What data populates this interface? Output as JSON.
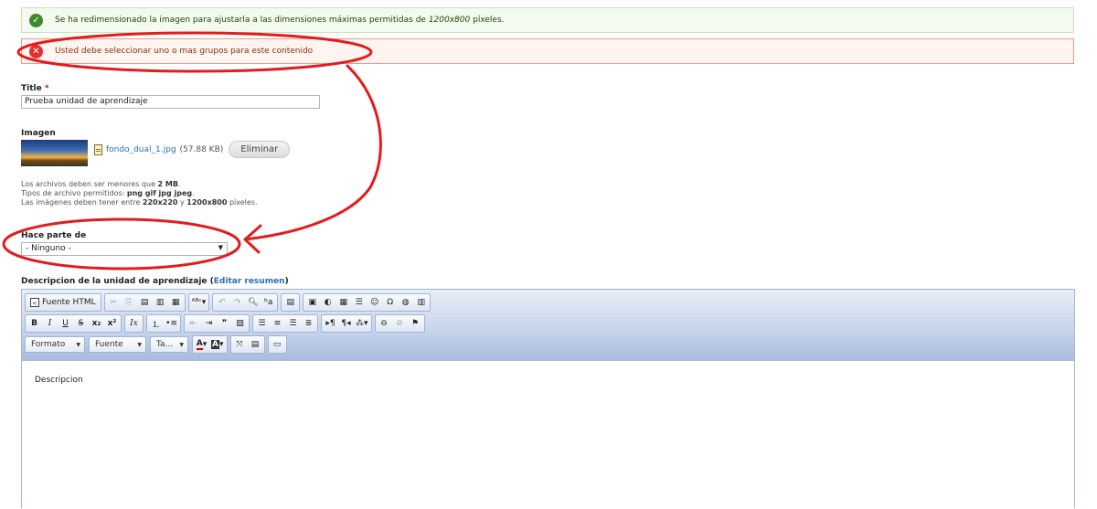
{
  "messages": {
    "ok_text": "Se ha redimensionado la imagen para ajustarla a las dimensiones máximas permitidas de ",
    "ok_dims": "1200x800",
    "ok_suffix": " píxeles.",
    "error_text": "Usted debe seleccionar uno o mas grupos para este contenido",
    "ok_icon": "check-icon",
    "error_icon": "error-x-icon"
  },
  "title_field": {
    "label": "Title",
    "required_mark": "*",
    "value": "Prueba unidad de aprendizaje"
  },
  "image_field": {
    "label": "Imagen",
    "file_name": "fondo_dual_1.jpg",
    "file_size": "(57.88 KB)",
    "remove_label": "Eliminar",
    "help_line1_prefix": "Los archivos deben ser menores que ",
    "help_line1_bold": "2 MB",
    "help_line1_suffix": ".",
    "help_line2_prefix": "Tipos de archivo permitidos: ",
    "help_line2_bold": "png gif jpg jpeg",
    "help_line2_suffix": ".",
    "help_line3_prefix": "Las imágenes deben tener entre ",
    "help_line3_bold1": "220x220",
    "help_line3_mid": " y ",
    "help_line3_bold2": "1200x800",
    "help_line3_suffix": " píxeles."
  },
  "group_field": {
    "label": "Hace parte de",
    "selected": "- Ninguno -"
  },
  "description_field": {
    "label": "Descripcion de la unidad de aprendizaje",
    "edit_summary_open": " (",
    "edit_summary_link": "Editar resumen",
    "edit_summary_close": ")",
    "content": "Descripcion"
  },
  "toolbar": {
    "source_label": "Fuente HTML",
    "bold": "B",
    "italic": "I",
    "underline": "U",
    "strike": "S",
    "subscript": "x₂",
    "superscript": "x²",
    "remove_format": "Ix",
    "format_label": "Formato",
    "font_label": "Fuente",
    "size_label": "Ta...",
    "text_color": "A",
    "bg_color": "A"
  },
  "annotation": {
    "stroke_color": "#e21c1c"
  }
}
